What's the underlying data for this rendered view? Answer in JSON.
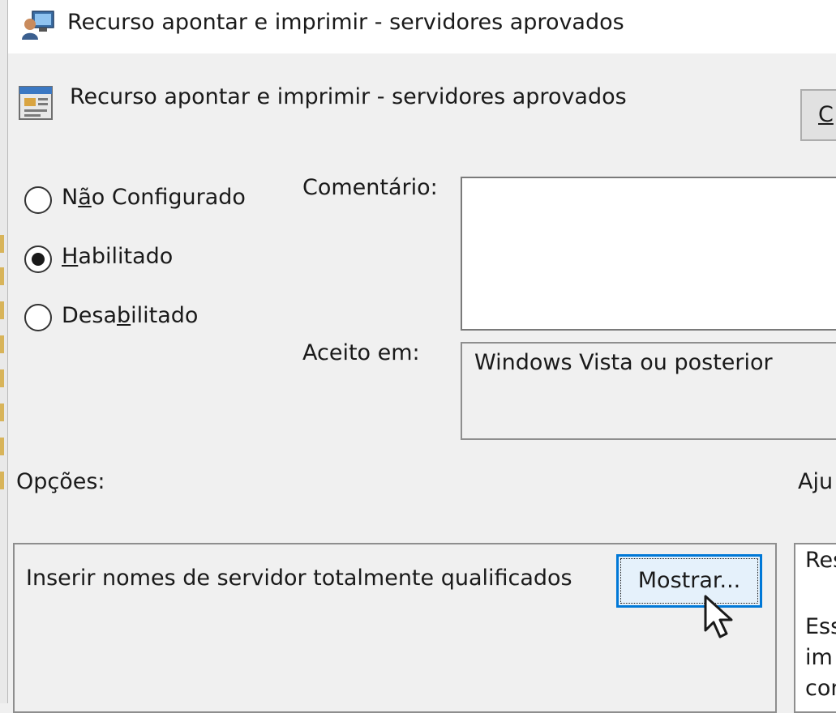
{
  "window": {
    "title": "Recurso apontar e imprimir - servidores aprovados",
    "icon": "group-policy-icon"
  },
  "header": {
    "setting_title": "Recurso apontar e imprimir - servidores aprovados",
    "setting_icon": "policy-setting-icon",
    "top_button_label": "C"
  },
  "state": {
    "options": [
      {
        "label_before": "N",
        "mnemonic": "ã",
        "label_after": "o Configurado",
        "checked": false
      },
      {
        "label_before": "",
        "mnemonic": "H",
        "label_after": "abilitado",
        "checked": true
      },
      {
        "label_before": "Desa",
        "mnemonic": "b",
        "label_after": "ilitado",
        "checked": false
      }
    ]
  },
  "comment": {
    "label": "Comentário:",
    "value": ""
  },
  "supported": {
    "label": "Aceito em:",
    "value": "Windows Vista ou posterior"
  },
  "options_section": {
    "label": "Opções:",
    "item_text": "Inserir nomes de servidor totalmente qualificados",
    "show_button": "Mostrar..."
  },
  "help_section": {
    "label": "Aju",
    "lines": [
      "Res",
      "",
      "Ess",
      "im",
      "con"
    ]
  }
}
